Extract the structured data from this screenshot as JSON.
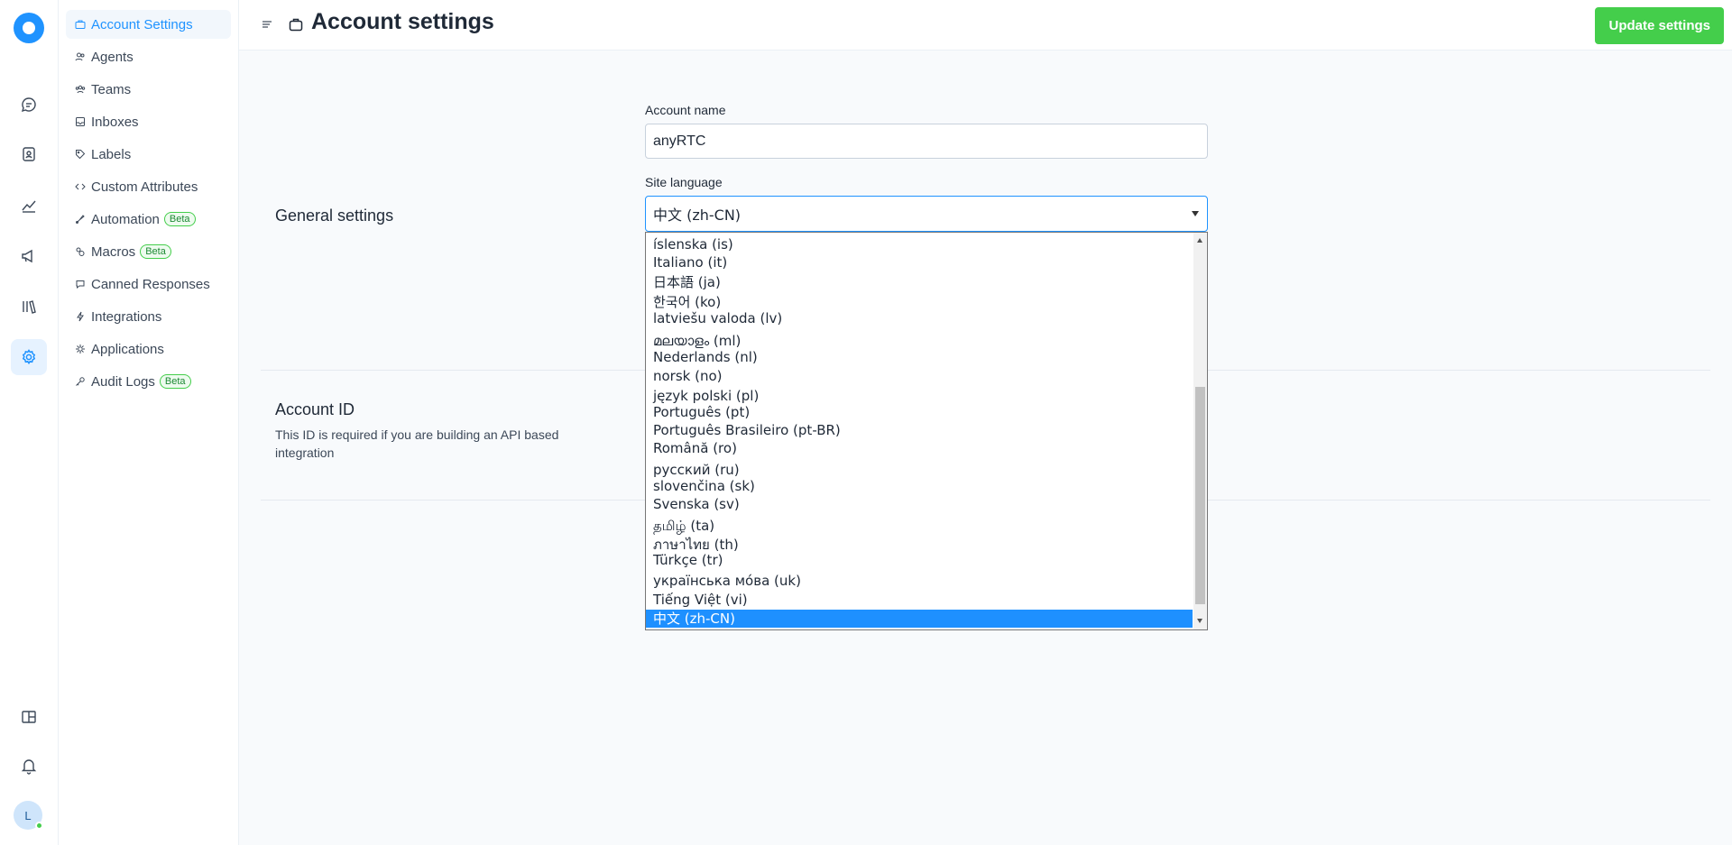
{
  "rail": {
    "items": [
      {
        "name": "conversations-icon"
      },
      {
        "name": "contacts-icon"
      },
      {
        "name": "reports-icon"
      },
      {
        "name": "campaigns-icon"
      },
      {
        "name": "library-icon"
      },
      {
        "name": "settings-icon",
        "active": true
      }
    ],
    "avatar_initial": "L"
  },
  "sidebar": {
    "items": [
      {
        "label": "Account Settings",
        "icon": "briefcase-icon",
        "active": true
      },
      {
        "label": "Agents",
        "icon": "people-icon"
      },
      {
        "label": "Teams",
        "icon": "team-icon"
      },
      {
        "label": "Inboxes",
        "icon": "inbox-icon"
      },
      {
        "label": "Labels",
        "icon": "tag-icon"
      },
      {
        "label": "Custom Attributes",
        "icon": "code-icon"
      },
      {
        "label": "Automation",
        "icon": "automation-icon",
        "badge": "Beta"
      },
      {
        "label": "Macros",
        "icon": "macros-icon",
        "badge": "Beta"
      },
      {
        "label": "Canned Responses",
        "icon": "chat-icon"
      },
      {
        "label": "Integrations",
        "icon": "flash-icon"
      },
      {
        "label": "Applications",
        "icon": "apps-icon"
      },
      {
        "label": "Audit Logs",
        "icon": "key-icon",
        "badge": "Beta"
      }
    ]
  },
  "header": {
    "title": "Account settings",
    "update_label": "Update settings"
  },
  "general": {
    "title": "General settings",
    "account_name_label": "Account name",
    "account_name_value": "anyRTC",
    "site_language_label": "Site language",
    "site_language_value": "中文 (zh-CN)"
  },
  "account_id": {
    "title": "Account ID",
    "description": "This ID is required if you are building an API based integration"
  },
  "language_options": [
    "íslenska (is)",
    "Italiano (it)",
    "日本語 (ja)",
    "한국어 (ko)",
    "latviešu valoda (lv)",
    "മലയാളം (ml)",
    "Nederlands (nl)",
    "norsk (no)",
    "język polski (pl)",
    "Português (pt)",
    "Português Brasileiro (pt-BR)",
    "Română (ro)",
    "русский (ru)",
    "slovenčina (sk)",
    "Svenska (sv)",
    "தமிழ் (ta)",
    "ภาษาไทย (th)",
    "Türkçe (tr)",
    "українська мо́ва (uk)",
    "Tiếng Việt (vi)",
    "中文 (zh-CN)"
  ],
  "selected_language_index": 20
}
